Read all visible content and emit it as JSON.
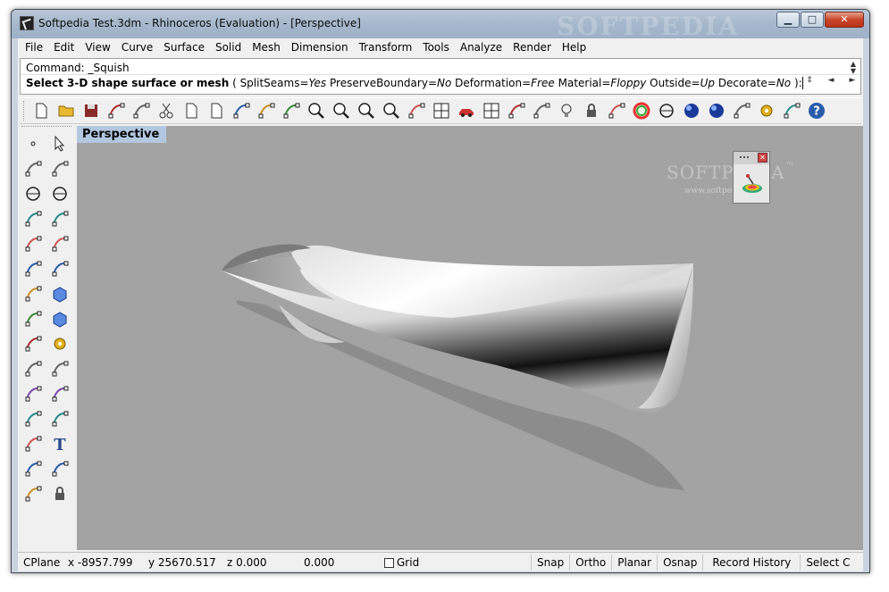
{
  "window": {
    "title": "Softpedia Test.3dm - Rhinoceros (Evaluation) - [Perspective]",
    "watermark": "SOFTPEDIA",
    "minimize_glyph": "▁",
    "maximize_glyph": "□",
    "close_glyph": "✕"
  },
  "menu": [
    "File",
    "Edit",
    "View",
    "Curve",
    "Surface",
    "Solid",
    "Mesh",
    "Dimension",
    "Transform",
    "Tools",
    "Analyze",
    "Render",
    "Help"
  ],
  "command": {
    "history": "Command: _Squish",
    "prompt_main": "Select 3-D shape surface or mesh",
    "open_paren": " ( ",
    "options": [
      {
        "name": "SplitSeams",
        "value": "Yes"
      },
      {
        "name": "PreserveBoundary",
        "value": "No"
      },
      {
        "name": "Deformation",
        "value": "Free"
      },
      {
        "name": "Material",
        "value": "Floppy"
      },
      {
        "name": "Outside",
        "value": "Up"
      },
      {
        "name": "Decorate",
        "value": "No"
      }
    ],
    "close_paren": " ): ",
    "scroll_up": "▲",
    "scroll_down": "▼",
    "nav_updown": "⇕",
    "nav_left": "◄",
    "nav_right": "►"
  },
  "toolbar_icons": [
    "new-file-icon",
    "open-folder-icon",
    "save-icon",
    "print-icon",
    "export-icon",
    "cut-icon",
    "copy-icon",
    "paste-icon",
    "undo-icon",
    "pan-hand-icon",
    "rotate-view-icon",
    "zoom-icon",
    "zoom-window-icon",
    "zoom-extents-icon",
    "zoom-selected-icon",
    "undo-view-icon",
    "four-viewports-icon",
    "car-icon",
    "grid-plane-icon",
    "cplane-icon",
    "osnap-icon",
    "light-bulb-icon",
    "lock-icon",
    "layer-icon",
    "color-wheel-icon",
    "wireframe-sphere-icon",
    "shaded-sphere-icon",
    "render-sphere-icon",
    "light-icon",
    "settings-gear-icon",
    "select-window-icon",
    "help-icon"
  ],
  "sidebar": {
    "col1": [
      "point-icon",
      "polyline-icon",
      "circle-icon",
      "rectangle-icon",
      "fillet-curve-icon",
      "surface-icon",
      "solid-union-icon",
      "mesh-icon",
      "explode-icon",
      "split-icon",
      "group-icon",
      "curve-from-object-icon",
      "transform-move-icon",
      "transform-array-icon",
      "dimension-icon"
    ],
    "col2": [
      "select-arrow-icon",
      "curve-icon",
      "arc-icon",
      "polygon-icon",
      "offset-curve-icon",
      "loft-icon",
      "box-icon",
      "cylinder-icon",
      "gear-tools-icon",
      "trim-icon",
      "boolean-icon",
      "blend-curve-icon",
      "text-icon",
      "array-icon",
      "block-icon"
    ]
  },
  "viewport": {
    "name": "Perspective",
    "watermark": "SOFTPEDIA",
    "watermark_tm": "™",
    "watermark_url": "www.softpedia.com",
    "floatpanel_close": "✕"
  },
  "status": {
    "cplane": "CPlane",
    "x": "x -8957.799",
    "y": "y 25670.517",
    "z": "z 0.000",
    "value": "0.000",
    "grid_label": "Grid",
    "grid_checked": false,
    "snap": "Snap",
    "ortho": "Ortho",
    "planar": "Planar",
    "osnap": "Osnap",
    "record_history": "Record History",
    "select": "Select C"
  }
}
